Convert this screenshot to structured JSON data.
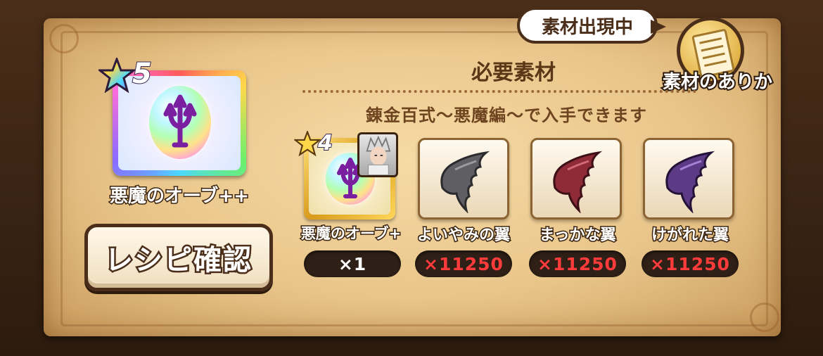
{
  "crafted_item": {
    "rarity": "5",
    "name": "悪魔のオーブ++",
    "icon": "devil-orb-rainbow"
  },
  "recipe_button": {
    "label": "レシピ確認"
  },
  "badge": {
    "label": "素材出現中"
  },
  "location_button": {
    "label": "素材のありか",
    "icon": "scroll-icon"
  },
  "required_section": {
    "title": "必要素材",
    "source": "錬金百式〜悪魔編〜で入手できます"
  },
  "materials": [
    {
      "name": "悪魔のオーブ+",
      "count": "×1",
      "rarity": "4",
      "icon": "devil-orb",
      "enough": true
    },
    {
      "name": "よいやみの翼",
      "count": "×11250",
      "icon": "gray-wing",
      "color": "#5e5e63",
      "enough": false
    },
    {
      "name": "まっかな翼",
      "count": "×11250",
      "icon": "red-wing",
      "color": "#8e2b37",
      "enough": false
    },
    {
      "name": "けがれた翼",
      "count": "×11250",
      "icon": "purple-wing",
      "color": "#5d3a86",
      "enough": false
    }
  ]
}
